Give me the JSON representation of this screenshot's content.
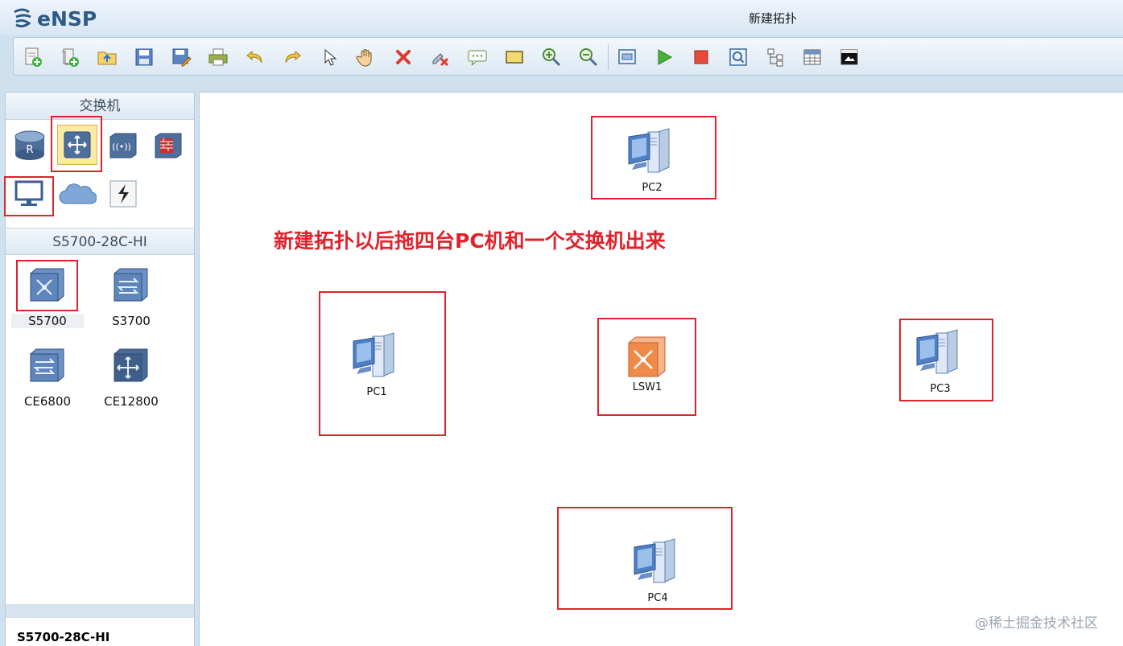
{
  "app": {
    "name": "eNSP",
    "window_title": "新建拓扑"
  },
  "toolbar": {
    "buttons": [
      "new-topology",
      "new-template",
      "open",
      "save",
      "save-as",
      "print",
      "undo",
      "redo",
      "select",
      "pan",
      "delete",
      "delete-link",
      "text",
      "shape",
      "zoom-in",
      "zoom-out",
      "device-config",
      "start",
      "stop",
      "capture",
      "topology-tree",
      "grid",
      "console"
    ]
  },
  "left_panel": {
    "category_title": "交换机",
    "device_type_title": "S5700-28C-HI",
    "devices": [
      {
        "label": "S5700"
      },
      {
        "label": "S3700"
      },
      {
        "label": "CE6800"
      },
      {
        "label": "CE12800"
      }
    ],
    "footer": "S5700-28C-HI"
  },
  "canvas": {
    "annotation": "新建拓扑以后拖四台PC机和一个交换机出来",
    "nodes": [
      {
        "label": "PC2"
      },
      {
        "label": "PC1"
      },
      {
        "label": "LSW1"
      },
      {
        "label": "PC3"
      },
      {
        "label": "PC4"
      }
    ]
  },
  "watermark": "@稀土掘金技术社区",
  "colors": {
    "highlight_box": "#e0222b",
    "switch_accent": "#f08a48",
    "pc_blue": "#4f7fc3"
  }
}
